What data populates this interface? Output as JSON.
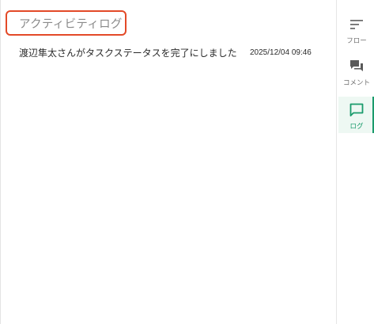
{
  "activity_log": {
    "title": "アクティビティログ",
    "entries": [
      {
        "message": "渡辺隼太さんがタスクステータスを完了にしました",
        "timestamp": "2025/12/04 09:46"
      }
    ]
  },
  "rail": {
    "items": [
      {
        "label": "フロー",
        "icon": "flow-icon",
        "active": false
      },
      {
        "label": "コメント",
        "icon": "comments-icon",
        "active": false
      },
      {
        "label": "ログ",
        "icon": "log-chat-icon",
        "active": true
      }
    ],
    "accent_color": "#1a9b6c",
    "highlight_border_color": "#e34a28"
  }
}
